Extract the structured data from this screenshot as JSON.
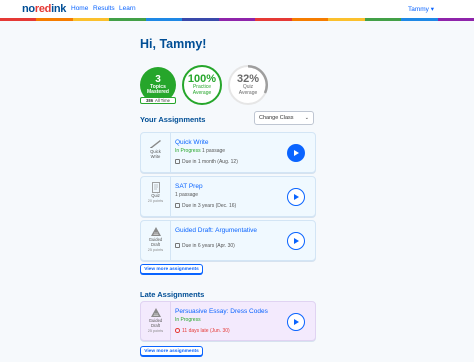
{
  "nav": {
    "logo_prefix": "no",
    "logo_red": "red",
    "logo_suffix": "ink",
    "links": [
      "Home",
      "Results",
      "Learn"
    ],
    "user": "Tammy",
    "user_caret": "▾",
    "rainbow_colors": [
      "#e53935",
      "#f57c00",
      "#fbc02d",
      "#43a047",
      "#1e88e5",
      "#3949ab",
      "#8e24aa",
      "#e53935",
      "#f57c00",
      "#fbc02d",
      "#43a047",
      "#1e88e5",
      "#8e24aa"
    ]
  },
  "greeting": "Hi, Tammy!",
  "stats": {
    "mastered_count": "3",
    "mastered_label_1": "Topics",
    "mastered_label_2": "Mastered",
    "alltime_count": "386",
    "alltime_label": "All Time",
    "practice_value": "100%",
    "practice_label_1": "Practice",
    "practice_label_2": "Average",
    "practice_fraction": 1.0,
    "quiz_value": "32%",
    "quiz_label_1": "Quiz",
    "quiz_label_2": "Average",
    "quiz_fraction": 0.32
  },
  "assignments": {
    "title": "Your Assignments",
    "class_select": "Change Class",
    "class_caret": "⌄",
    "items": [
      {
        "type_1": "Quick",
        "type_2": "Write",
        "points": "",
        "title": "Quick Write",
        "status": "In Progress",
        "passage": "1 passage",
        "due": "Due in 1 month (Aug. 12)",
        "icon": "quick-write-icon"
      },
      {
        "type_1": "Quiz",
        "type_2": "",
        "points": "20 points",
        "title": "SAT Prep",
        "status": "",
        "passage": "1 passage",
        "due": "Due in 3 years (Dec. 16)",
        "icon": "quiz-icon"
      },
      {
        "type_1": "Guided",
        "type_2": "Draft",
        "points": "25 points",
        "title": "Guided Draft: Argumentative",
        "status": "",
        "passage": "",
        "due": "Due in 6 years (Apr. 30)",
        "icon": "guided-draft-icon"
      }
    ],
    "more_button": "View more assignments"
  },
  "late": {
    "title": "Late Assignments",
    "items": [
      {
        "type_1": "Guided",
        "type_2": "Draft",
        "points": "25 points",
        "title": "Persuasive Essay: Dress Codes",
        "status": "In Progress",
        "due": "11 days late (Jun. 30)",
        "icon": "guided-draft-icon"
      }
    ],
    "more_button": "View more assignments"
  },
  "colors": {
    "brand_blue": "#0a64ff",
    "navy": "#004e95",
    "green": "#26a62b",
    "late_purple": "#f3eafd",
    "red": "#e53935"
  }
}
